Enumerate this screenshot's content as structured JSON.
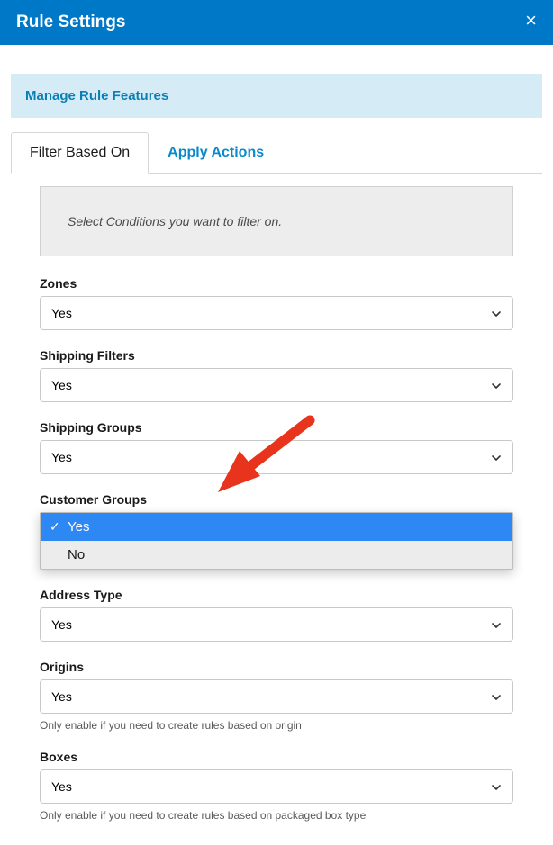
{
  "header": {
    "title": "Rule Settings",
    "close": "×"
  },
  "banner": {
    "text": "Manage Rule Features"
  },
  "tabs": {
    "filter": "Filter Based On",
    "actions": "Apply Actions"
  },
  "instruction": "Select Conditions you want to filter on.",
  "fields": {
    "zones": {
      "label": "Zones",
      "value": "Yes"
    },
    "shipping_filters": {
      "label": "Shipping Filters",
      "value": "Yes"
    },
    "shipping_groups": {
      "label": "Shipping Groups",
      "value": "Yes"
    },
    "customer_groups": {
      "label": "Customer Groups",
      "options": {
        "yes": "Yes",
        "no": "No"
      }
    },
    "address_type": {
      "label": "Address Type",
      "value": "Yes"
    },
    "origins": {
      "label": "Origins",
      "value": "Yes",
      "helper": "Only enable if you need to create rules based on origin"
    },
    "boxes": {
      "label": "Boxes",
      "value": "Yes",
      "helper": "Only enable if you need to create rules based on packaged box type"
    }
  }
}
